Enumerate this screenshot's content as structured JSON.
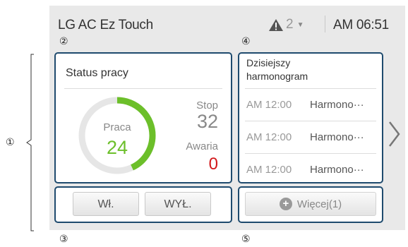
{
  "header": {
    "title": "LG AC Ez Touch",
    "alert_count": "2",
    "time": "AM 06:51"
  },
  "status": {
    "title": "Status pracy",
    "running_label": "Praca",
    "running_value": "24",
    "stop_label": "Stop",
    "stop_value": "32",
    "error_label": "Awaria",
    "error_value": "0",
    "running_share": 0.43
  },
  "controls": {
    "on_label": "Wł.",
    "off_label": "WYŁ."
  },
  "schedule": {
    "title": "Dzisiejszy harmonogram",
    "items": [
      {
        "time": "AM 12:00",
        "name": "Harmono···"
      },
      {
        "time": "AM 12:00",
        "name": "Harmono···"
      },
      {
        "time": "AM 12:00",
        "name": "Harmono···"
      }
    ],
    "more_label": "Więcej(1)"
  },
  "callouts": [
    "①",
    "②",
    "③",
    "④",
    "⑤"
  ],
  "colors": {
    "panel_border": "#1f4b6e",
    "running": "#6cbf2a",
    "error": "#d2191c"
  }
}
